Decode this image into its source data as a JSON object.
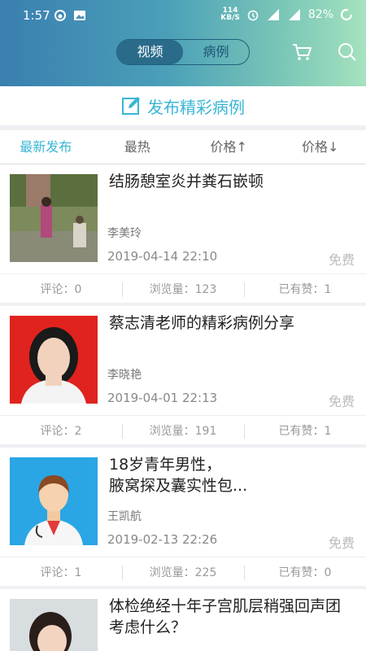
{
  "status_bar": {
    "time": "1:57",
    "speed_value": "114",
    "speed_unit": "KB/S",
    "battery": "82%"
  },
  "header": {
    "tabs": [
      {
        "label": "视频",
        "active": true
      },
      {
        "label": "病例",
        "active": false
      }
    ]
  },
  "publish": {
    "label": "发布精彩病例"
  },
  "sort_tabs": [
    {
      "label": "最新发布",
      "active": true
    },
    {
      "label": "最热",
      "active": false
    },
    {
      "label": "价格↑",
      "active": false
    },
    {
      "label": "价格↓",
      "active": false
    }
  ],
  "cases": [
    {
      "title": "结肠憩室炎并粪石嵌顿",
      "author": "李美玲",
      "date": "2019-04-14 22:10",
      "price": "免费",
      "comments": "评论：0",
      "views": "浏览量：123",
      "likes": "已有赞：1"
    },
    {
      "title": "蔡志清老师的精彩病例分享",
      "author": "李晓艳",
      "date": "2019-04-01 22:13",
      "price": "免费",
      "comments": "评论：2",
      "views": "浏览量：191",
      "likes": "已有赞：1"
    },
    {
      "title": "18岁青年男性，\n腋窝探及囊实性包...",
      "author": "王凯航",
      "date": "2019-02-13 22:26",
      "price": "免费",
      "comments": "评论：1",
      "views": "浏览量：225",
      "likes": "已有赞：0"
    },
    {
      "title": "体检绝经十年子宫肌层稍强回声团\n考虑什么？",
      "author": "",
      "date": "",
      "price": "",
      "comments": "",
      "views": "",
      "likes": ""
    }
  ],
  "colors": {
    "accent": "#39b6d6",
    "header_start": "#3a7fb0",
    "header_end": "#a6e2be"
  }
}
